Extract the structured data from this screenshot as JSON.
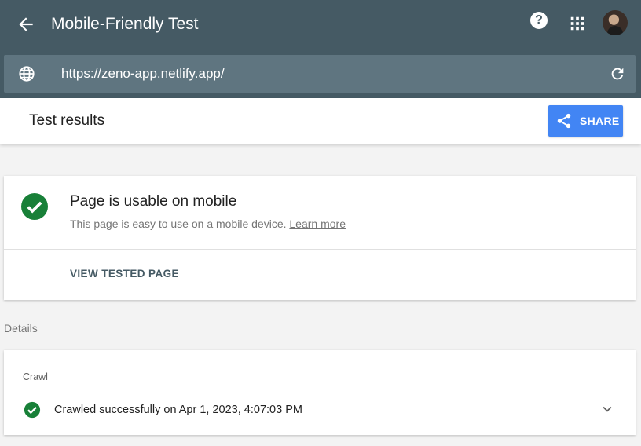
{
  "topbar": {
    "title": "Mobile-Friendly Test",
    "back_icon": "arrow-back-icon",
    "help_icon": "help-icon",
    "help_glyph": "?",
    "apps_icon": "apps-grid-icon",
    "avatar": "user-avatar"
  },
  "urlbar": {
    "globe_icon": "globe-icon",
    "url": "https://zeno-app.netlify.app/",
    "reload_icon": "reload-icon"
  },
  "results_header": {
    "title": "Test results",
    "share_label": "SHARE",
    "share_icon": "share-icon"
  },
  "status_card": {
    "icon": "check-circle-icon",
    "title": "Page is usable on mobile",
    "description": "This page is easy to use on a mobile device.",
    "learn_more": "Learn more",
    "view_tested_page": "VIEW TESTED PAGE"
  },
  "details": {
    "label": "Details"
  },
  "crawl_card": {
    "heading": "Crawl",
    "icon": "check-circle-icon",
    "status": "Crawled successfully on Apr 1, 2023, 4:07:03 PM",
    "expand_icon": "chevron-down-icon"
  },
  "colors": {
    "topbar": "#455a64",
    "urlbar": "#5f7580",
    "share_button": "#4285f4",
    "success_green": "#188038",
    "page_background": "#f3f3f3"
  }
}
